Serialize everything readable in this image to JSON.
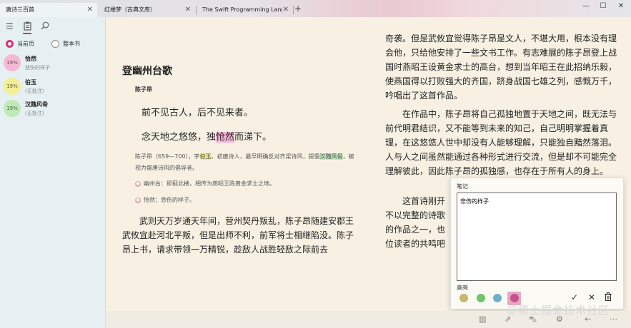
{
  "tabs": [
    {
      "label": "唐诗三百首",
      "active": true
    },
    {
      "label": "红楼梦（古典文库）",
      "active": false
    },
    {
      "label": "The Swift Programming Language (S",
      "active": false
    }
  ],
  "window": {
    "close_tab": "✕",
    "new_tab": "+",
    "minimize": "—",
    "maximize": "☐",
    "close": "✕"
  },
  "sidebar": {
    "scope_current": "当前页",
    "scope_book": "整本书",
    "items": [
      {
        "badge": "19%",
        "title": "恰然",
        "sub": "悲伤的样子",
        "color": "#f6b8d2"
      },
      {
        "badge": "19%",
        "title": "伯玉",
        "sub": "(无批注)",
        "color": "#f3ee92"
      },
      {
        "badge": "19%",
        "title": "汉魏风骨",
        "sub": "(无批注)",
        "color": "#bdeab6"
      }
    ]
  },
  "poem": {
    "title": "登幽州台歌",
    "author": "陈子昂",
    "line1": "前不见古人，后不见来者。",
    "line2_a": "念天地之悠悠，独",
    "line2_hl": "怆然",
    "line2_b": "而涕下。",
    "bio_a": "陈子昂（659—700），字",
    "bio_hl1": "伯玉",
    "bio_b": "，初唐诗人，最早明确反对齐梁诗风，提倡",
    "bio_hl2": "汉魏风骨",
    "bio_c": "，被视为盛唐诗风的倡导者。",
    "note1": "幽州台：即蓟北楼，相传为燕昭王陈黄金求士之地。",
    "note2": "怆然：悲伤的样子。",
    "para1": "武则天万岁通天年间，营州契丹叛乱，陈子昂随建安郡王武攸宜赴河北平叛，但是出师不利，前军将士相继陷没。陈子昂上书，请求带领一万精锐，趁敌人战胜轻敌之际前去",
    "right1": "奇袭。但是武攸宜觉得陈子昂是文人，不堪大用，根本没有理会他，只给他安排了一些文书工作。有志难展的陈子昂登上战国时燕昭王设黄金求士的高台，想到当年昭王在此招纳乐毅，使燕国得以打败强大的齐国，跻身战国七雄之列，感慨万千，吟唱出了这首作品。",
    "right2": "在作品中，陈子昂将自己孤独地置于天地之间，既无法与前代明君结识，又不能等到未来的知己，自己明明掌握着真理，在这悠悠人世中却没有人能够理解，只能独自黯然落泪。人与人之间虽然能通过各种形式进行交流，但是却不可能完全理解彼此，因此陈子昂的孤独感，也存在于所有人的身上。",
    "right3_a": "这首诗刚开",
    "right3_b": "不以完整的诗歌",
    "right3_c": "的作品之一，也",
    "right3_d": "位读者的共鸣吧"
  },
  "notes_panel": {
    "label": "笔记",
    "content": "悲伤的样子",
    "highlight_label": "高亮",
    "colors": [
      "#c5b76b",
      "#6ec56b",
      "#6fb0c9",
      "#c8508c"
    ],
    "confirm": "✓",
    "cancel": "✕",
    "delete": "🗑"
  },
  "watermark": "@稀土掘金技术社区"
}
